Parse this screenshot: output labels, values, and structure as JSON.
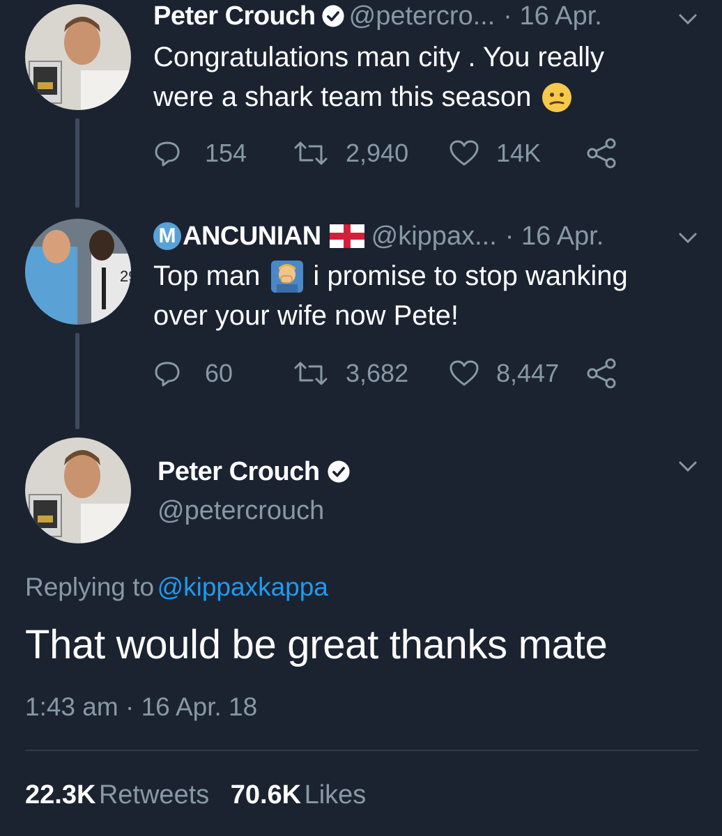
{
  "tweet1": {
    "name": "Peter Crouch",
    "handle": "@petercro...",
    "date": "· 16 Apr.",
    "text_line1": "Congratulations man city . You really",
    "text_line2": "were a shark team this season",
    "emoji": "confused-face-emoji",
    "replies": "154",
    "retweets": "2,940",
    "likes": "14K"
  },
  "tweet2": {
    "name_first": "M",
    "name_rest": "ANCUNIAN",
    "flag": "england-flag-icon",
    "handle": "@kippax...",
    "date": "· 16 Apr.",
    "text_line1_a": "Top man",
    "text_line1_b": "i promise to stop wanking",
    "text_line2": "over your wife now Pete!",
    "emoji": "man-facepalming-emoji",
    "replies": "60",
    "retweets": "3,682",
    "likes": "8,447"
  },
  "main_tweet": {
    "name": "Peter Crouch",
    "handle": "@petercrouch",
    "replying_label": "Replying to",
    "replying_handle": "@kippaxkappa",
    "text": "That would be great thanks mate",
    "timestamp": "1:43 am · 16 Apr. 18",
    "retweets_count": "22.3K",
    "retweets_label": "Retweets",
    "likes_count": "70.6K",
    "likes_label": "Likes"
  },
  "colors": {
    "background": "#1b2331",
    "secondary_text": "#8899a6",
    "link": "#1d9bf0",
    "verified": "#ffffff"
  }
}
